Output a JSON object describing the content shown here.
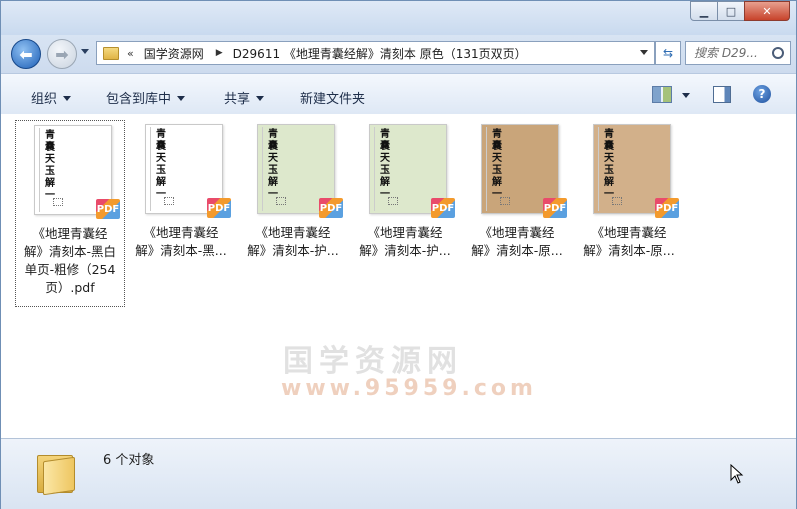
{
  "window": {
    "min_icon": "minimize-icon",
    "max_icon": "maximize-icon",
    "close_icon": "close-icon"
  },
  "nav": {
    "back_icon": "back-arrow-icon",
    "forward_icon": "forward-arrow-icon",
    "breadcrumb_overflow": "«",
    "breadcrumbs": [
      "国学资源网",
      "D29611 《地理青囊经解》清刻本 原色（131页双页）"
    ],
    "refresh_icon": "refresh-icon",
    "search_placeholder": "搜索 D29..."
  },
  "toolbar": {
    "organize": "组织",
    "include_in_library": "包含到库中",
    "share": "共享",
    "new_folder": "新建文件夹",
    "view_icon": "change-view-icon",
    "preview_icon": "preview-pane-icon",
    "help_icon": "help-icon"
  },
  "files": [
    {
      "line1": "《地理青囊经",
      "line2": "解》清刻本-黑白",
      "line3": "单页-粗修（254",
      "line4": "页）.pdf",
      "paper": "#ffffff",
      "selected": true
    },
    {
      "line1": "《地理青囊经",
      "line2": "解》清刻本-黑...",
      "paper": "#ffffff",
      "selected": false
    },
    {
      "line1": "《地理青囊经",
      "line2": "解》清刻本-护...",
      "paper": "#dde8cc",
      "selected": false
    },
    {
      "line1": "《地理青囊经",
      "line2": "解》清刻本-护...",
      "paper": "#dde8cc",
      "selected": false
    },
    {
      "line1": "《地理青囊经",
      "line2": "解》清刻本-原...",
      "paper": "#c9a57a",
      "selected": false
    },
    {
      "line1": "《地理青囊经",
      "line2": "解》清刻本-原...",
      "paper": "#d2b08a",
      "selected": false
    }
  ],
  "thumbnail_text": [
    "青",
    "囊",
    "天",
    "玉",
    "解",
    "一"
  ],
  "pdf_badge": "PDF",
  "watermark": {
    "line1": "国学资源网",
    "line2": "www.95959.com"
  },
  "status": {
    "count_text": "6 个对象",
    "icon": "folder-icon"
  }
}
